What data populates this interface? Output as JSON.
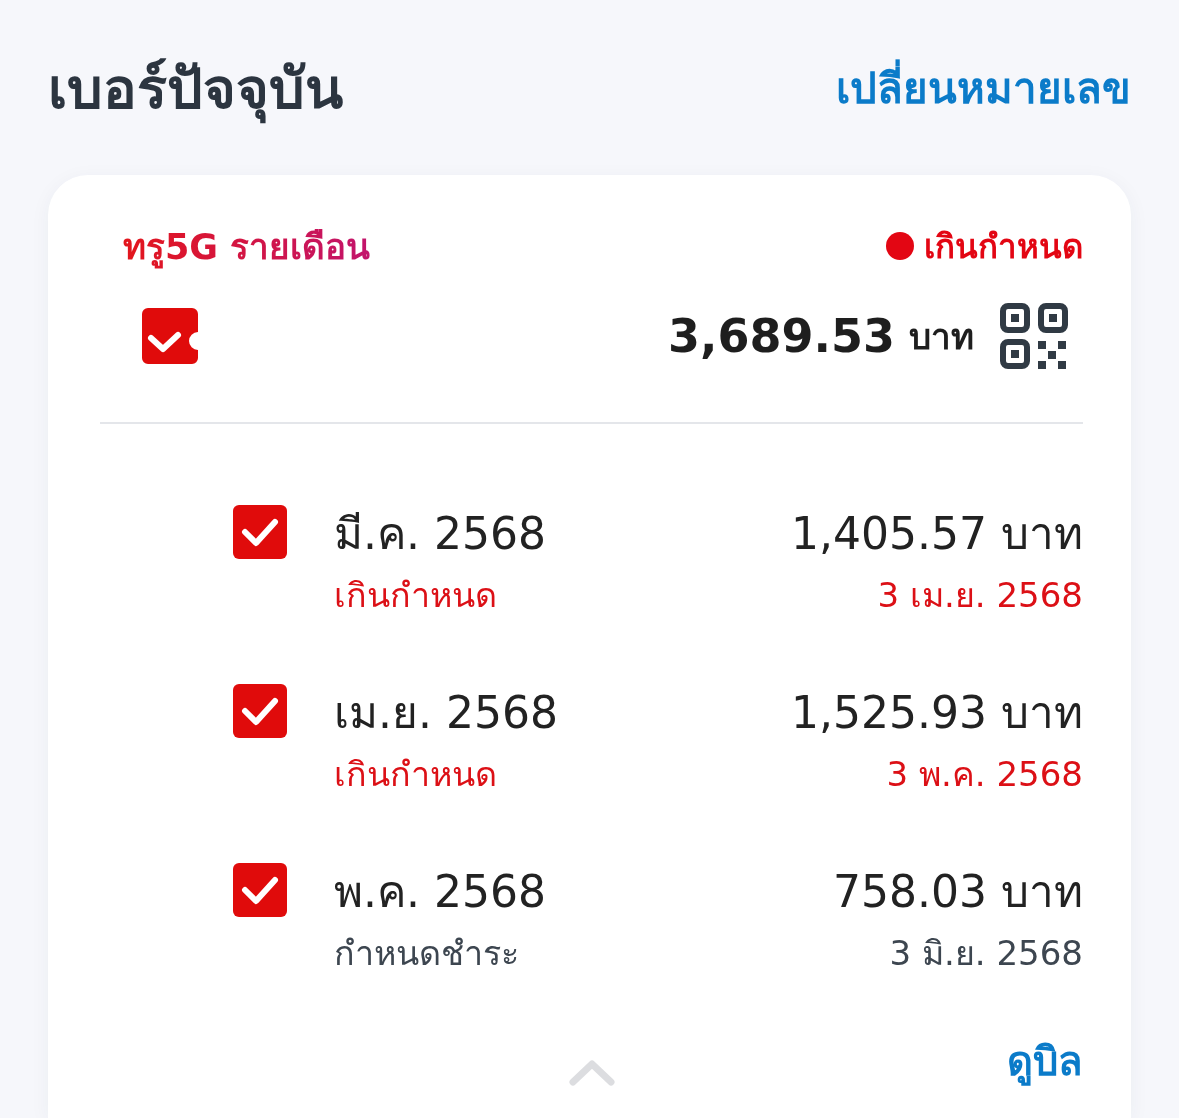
{
  "header": {
    "title": "เบอร์ปัจจุบัน",
    "change_number_link": "เปลี่ยนหมายเลข"
  },
  "account": {
    "plan": "ทรู5G รายเดือน",
    "status": {
      "label": "เกินกำหนด",
      "overdue": true
    },
    "select_all": {
      "checked": true
    },
    "total": "3,689.53",
    "currency": "บาท"
  },
  "bills": [
    {
      "month": "มี.ค. 2568",
      "status": "เกินกำหนด",
      "overdue": true,
      "amount": "1,405.57",
      "currency": "บาท",
      "date": "3 เม.ย. 2568",
      "checked": true
    },
    {
      "month": "เม.ย. 2568",
      "status": "เกินกำหนด",
      "overdue": true,
      "amount": "1,525.93",
      "currency": "บาท",
      "date": "3 พ.ค. 2568",
      "checked": true
    },
    {
      "month": "พ.ค. 2568",
      "status": "กำหนดชำระ",
      "overdue": false,
      "amount": "758.03",
      "currency": "บาท",
      "date": "3 มิ.ย. 2568",
      "checked": true
    }
  ],
  "footer": {
    "view_bill_link": "ดูบิล"
  }
}
